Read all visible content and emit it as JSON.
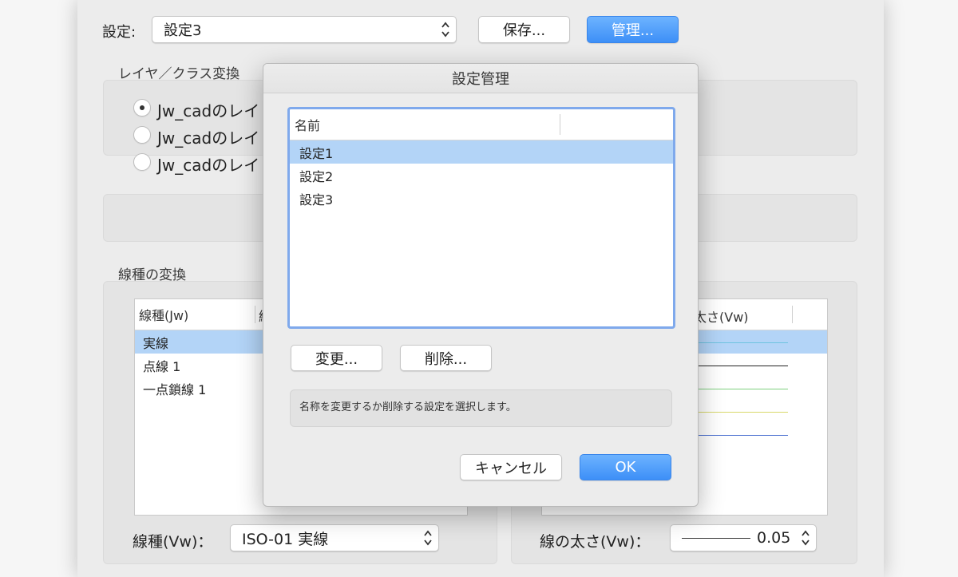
{
  "top": {
    "setting_label": "設定:",
    "setting_value": "設定3",
    "save_button": "保存...",
    "manage_button": "管理..."
  },
  "layer_group": {
    "label": "レイヤ／クラス変換",
    "options": [
      {
        "label": "Jw_cadのレイ",
        "selected": true
      },
      {
        "label": "Jw_cadのレイ",
        "selected": false
      },
      {
        "label": "Jw_cadのレイ",
        "selected": false
      }
    ]
  },
  "linetype_group": {
    "label": "線種の変換",
    "left_table": {
      "header": "線種(Jw)",
      "header2_partial": "線",
      "rows": [
        "実線",
        "点線 1",
        "一点鎖線 1"
      ]
    },
    "right_table": {
      "header": "太さ(Vw)"
    },
    "linetype_label": "線種(Vw)：",
    "linetype_value": "ISO-01 実線",
    "thickness_label": "線の太さ(Vw)：",
    "thickness_value": "0.05"
  },
  "line_colors": [
    "#6ec3e0",
    "#222222",
    "#7fd07f",
    "#d8d86a",
    "#4a6fd0"
  ],
  "dialog": {
    "title": "設定管理",
    "list_header": "名前",
    "items": [
      "設定1",
      "設定2",
      "設定3"
    ],
    "selected_index": 0,
    "rename_button": "変更...",
    "delete_button": "削除...",
    "info_text": "名称を変更するか削除する設定を選択します。",
    "cancel_button": "キャンセル",
    "ok_button": "OK"
  }
}
